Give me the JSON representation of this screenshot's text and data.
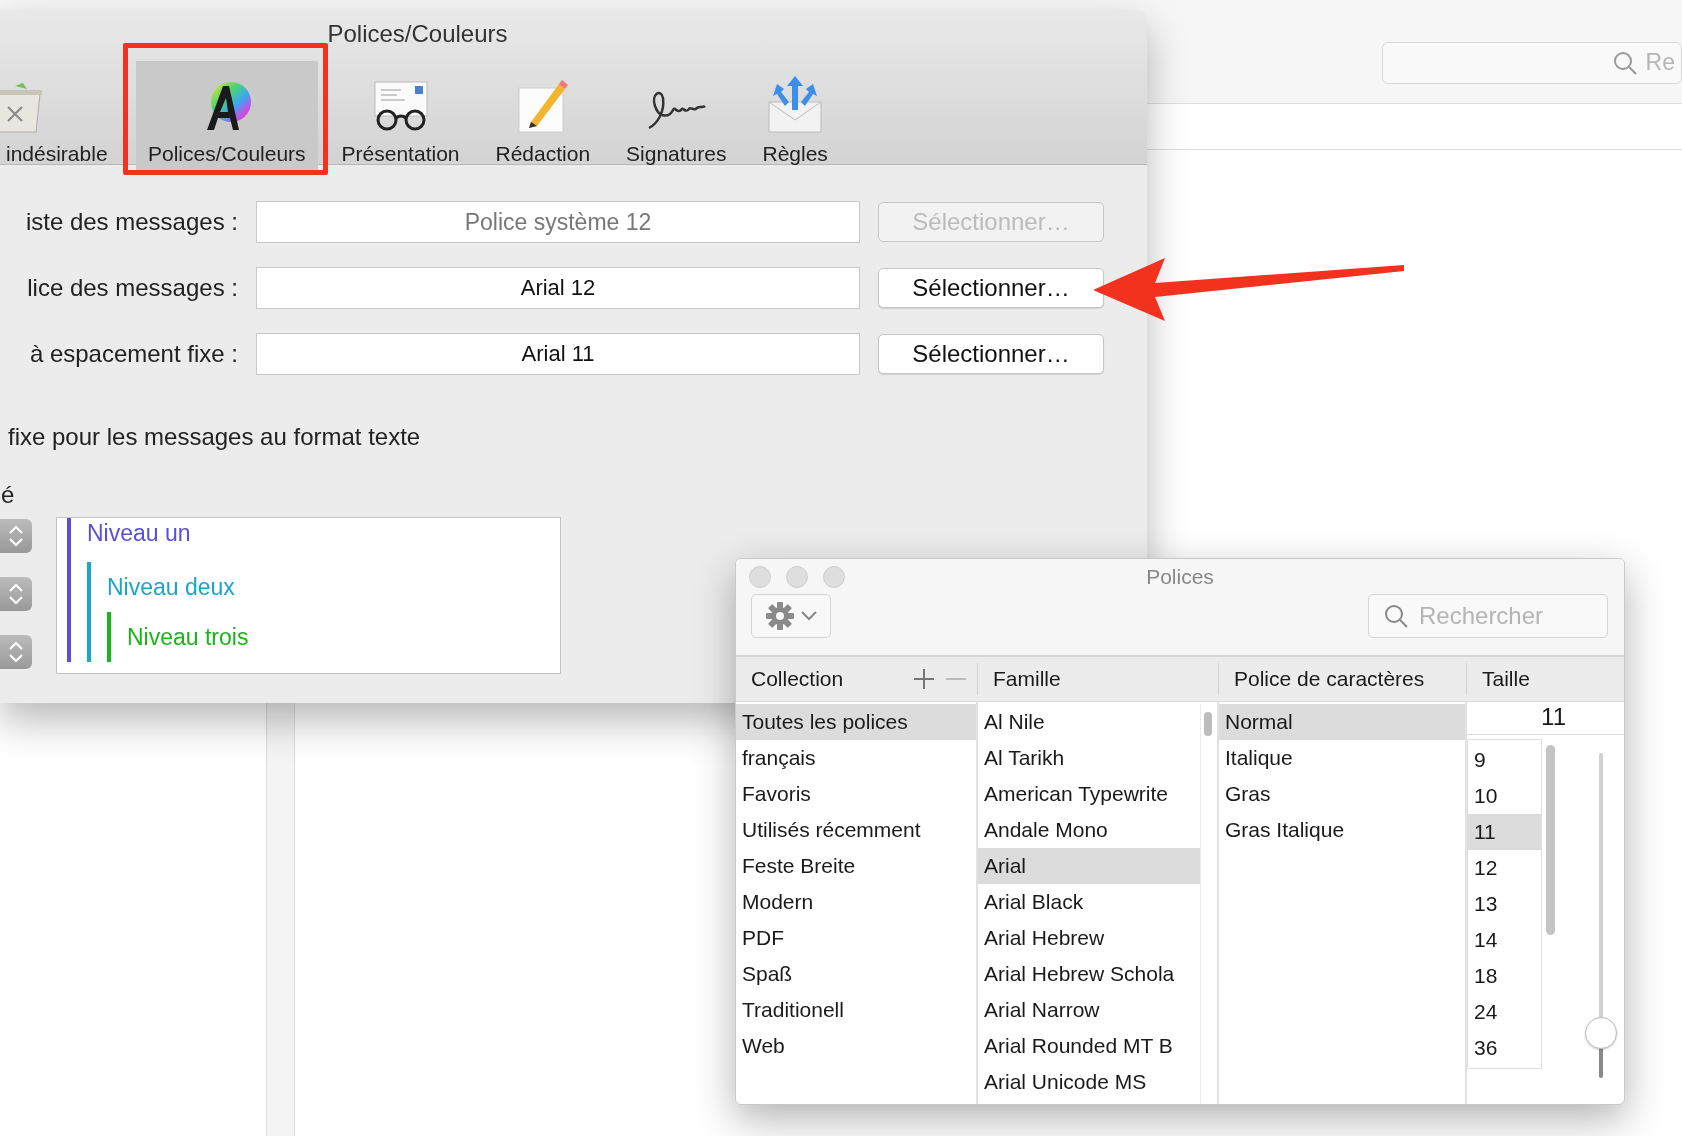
{
  "background_window": {
    "search": {
      "placeholder": "Re"
    }
  },
  "preferences": {
    "title": "Polices/Couleurs",
    "toolbar": [
      {
        "label": "indésirable",
        "selected": false
      },
      {
        "label": "Polices/Couleurs",
        "selected": true
      },
      {
        "label": "Présentation",
        "selected": false
      },
      {
        "label": "Rédaction",
        "selected": false
      },
      {
        "label": "Signatures",
        "selected": false
      },
      {
        "label": "Règles",
        "selected": false
      }
    ],
    "font_rows": [
      {
        "label": "iste des messages :",
        "value": "Police système 12",
        "button": "Sélectionner…",
        "disabled": true
      },
      {
        "label": "lice des messages :",
        "value": "Arial 12",
        "button": "Sélectionner…",
        "disabled": false
      },
      {
        "label": "à espacement fixe :",
        "value": "Arial 11",
        "button": "Sélectionner…",
        "disabled": false
      }
    ],
    "option_text": "fixe pour les messages au format texte",
    "cut_label": "é",
    "quote_levels": [
      {
        "text": "Niveau un",
        "color": "#5a4fd6"
      },
      {
        "text": "Niveau deux",
        "color": "#1aa6c9"
      },
      {
        "text": "Niveau trois",
        "color": "#1bb51b"
      }
    ]
  },
  "fonts_panel": {
    "title": "Polices",
    "search": {
      "placeholder": "Rechercher"
    },
    "columns": [
      "Collection",
      "Famille",
      "Police de caractères",
      "Taille"
    ],
    "collections": [
      {
        "label": "Toutes les polices",
        "selected": true
      },
      {
        "label": "français",
        "selected": false
      },
      {
        "label": "Favoris",
        "selected": false
      },
      {
        "label": "Utilisés récemment",
        "selected": false
      },
      {
        "label": "Feste Breite",
        "selected": false
      },
      {
        "label": "Modern",
        "selected": false
      },
      {
        "label": "PDF",
        "selected": false
      },
      {
        "label": "Spaß",
        "selected": false
      },
      {
        "label": "Traditionell",
        "selected": false
      },
      {
        "label": "Web",
        "selected": false
      }
    ],
    "families": [
      {
        "label": "Al Nile",
        "selected": false
      },
      {
        "label": "Al Tarikh",
        "selected": false
      },
      {
        "label": "American Typewrite",
        "selected": false
      },
      {
        "label": "Andale Mono",
        "selected": false
      },
      {
        "label": "Arial",
        "selected": true
      },
      {
        "label": "Arial Black",
        "selected": false
      },
      {
        "label": "Arial Hebrew",
        "selected": false
      },
      {
        "label": "Arial Hebrew Schola",
        "selected": false
      },
      {
        "label": "Arial Narrow",
        "selected": false
      },
      {
        "label": "Arial Rounded MT B",
        "selected": false
      },
      {
        "label": "Arial Unicode MS",
        "selected": false
      }
    ],
    "typefaces": [
      {
        "label": "Normal",
        "selected": true
      },
      {
        "label": "Italique",
        "selected": false
      },
      {
        "label": "Gras",
        "selected": false
      },
      {
        "label": "Gras Italique",
        "selected": false
      }
    ],
    "size": {
      "value": "11",
      "level": 0.14,
      "sizes": [
        {
          "label": "9",
          "selected": false
        },
        {
          "label": "10",
          "selected": false
        },
        {
          "label": "11",
          "selected": true
        },
        {
          "label": "12",
          "selected": false
        },
        {
          "label": "13",
          "selected": false
        },
        {
          "label": "14",
          "selected": false
        },
        {
          "label": "18",
          "selected": false
        },
        {
          "label": "24",
          "selected": false
        },
        {
          "label": "36",
          "selected": false
        }
      ]
    }
  }
}
